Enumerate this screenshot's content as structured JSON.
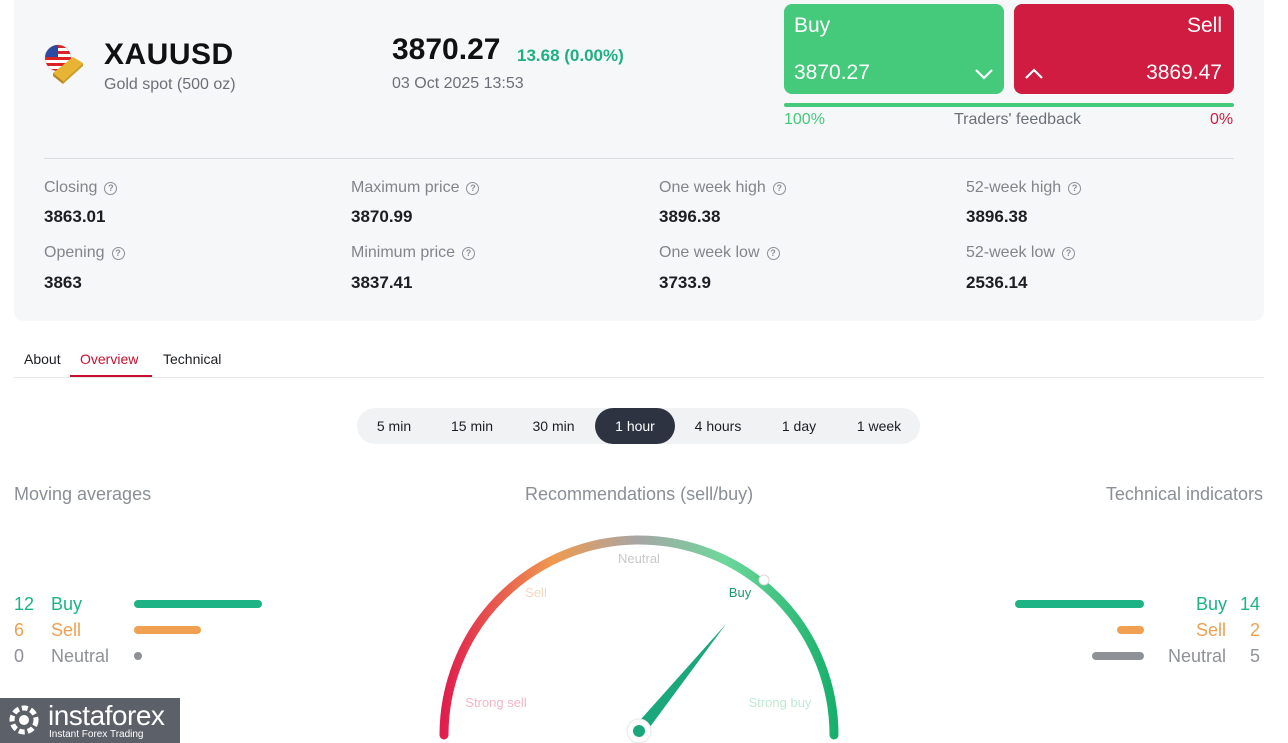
{
  "instrument": {
    "symbol": "XAUUSD",
    "subtitle": "Gold spot (500 oz)",
    "price": "3870.27",
    "change": "13.68 (0.00%)",
    "datetime": "03 Oct 2025 13:53"
  },
  "trade": {
    "buy_label": "Buy",
    "buy_value": "3870.27",
    "sell_label": "Sell",
    "sell_value": "3869.47",
    "buy_pct": "100%",
    "feedback_label": "Traders' feedback",
    "sell_pct": "0%"
  },
  "stats": [
    {
      "label": "Closing",
      "value": "3863.01"
    },
    {
      "label": "Opening",
      "value": "3863"
    },
    {
      "label": "Maximum price",
      "value": "3870.99"
    },
    {
      "label": "Minimum price",
      "value": "3837.41"
    },
    {
      "label": "One week high",
      "value": "3896.38"
    },
    {
      "label": "One week low",
      "value": "3733.9"
    },
    {
      "label": "52-week high",
      "value": "3896.38"
    },
    {
      "label": "52-week low",
      "value": "2536.14"
    }
  ],
  "tabs": [
    {
      "label": "About"
    },
    {
      "label": "Overview",
      "active": true
    },
    {
      "label": "Technical"
    }
  ],
  "periods": [
    "5 min",
    "15 min",
    "30 min",
    "1 hour",
    "4 hours",
    "1 day",
    "1 week"
  ],
  "active_period": "1 hour",
  "moving_averages": {
    "title": "Moving averages",
    "buy": {
      "count": "12",
      "label": "Buy"
    },
    "sell": {
      "count": "6",
      "label": "Sell"
    },
    "neutral": {
      "count": "0",
      "label": "Neutral"
    }
  },
  "recommendations": {
    "title": "Recommendations (sell/buy)",
    "labels": {
      "neutral": "Neutral",
      "sell": "Sell",
      "buy": "Buy",
      "strong_sell": "Strong sell",
      "strong_buy": "Strong buy"
    }
  },
  "technical_indicators": {
    "title": "Technical indicators",
    "buy": {
      "count": "14",
      "label": "Buy"
    },
    "sell": {
      "count": "2",
      "label": "Sell"
    },
    "neutral": {
      "count": "5",
      "label": "Neutral"
    }
  },
  "logo": {
    "name": "instaforex",
    "tagline": "Instant Forex Trading"
  },
  "colors": {
    "buy": "#1db384",
    "sell": "#f0a050",
    "neutral": "#8e9196",
    "accent_red": "#c8102e",
    "buy_box": "#45c97b",
    "sell_box": "#d01c40"
  },
  "icons": [
    "us-flag-gold-icon",
    "chevron-down-icon",
    "chevron-up-icon",
    "help-icon"
  ]
}
